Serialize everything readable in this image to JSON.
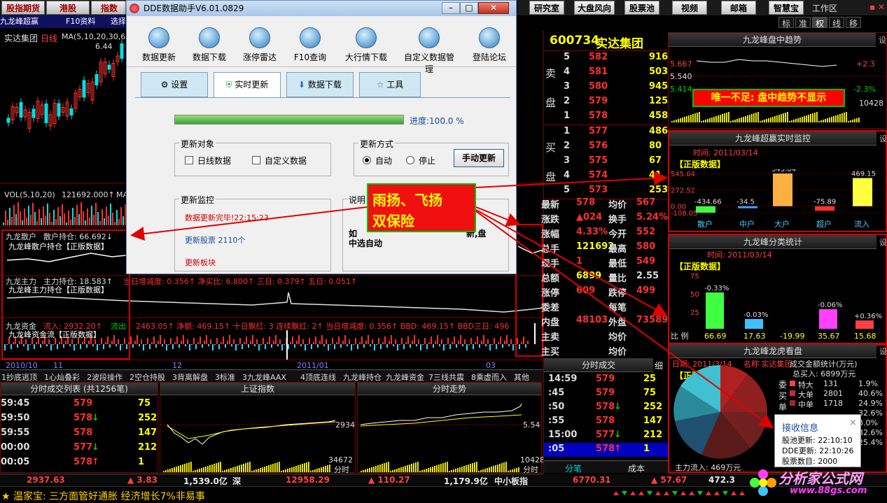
{
  "topbar": {
    "left": [
      "股指期货",
      "港股",
      "指数"
    ],
    "right": [
      "研究室",
      "大盘风向",
      "股票池",
      "视频",
      "邮箱",
      "智慧宝"
    ],
    "workspace": "工作区",
    "right_tabs": [
      "标",
      "准",
      "权",
      "线",
      "移"
    ]
  },
  "chart": {
    "stock_title": "实达集团",
    "period": "日线",
    "ma_label": "MA(5,10,20,30,60)",
    "price_tag": "6.44",
    "vol_label": "VOL(5,10,20)",
    "vol_value": "121692.000↑",
    "vol_ma": "MA",
    "retail_label": "九龙散户",
    "retail_value": "散户持仓: 66.692↓",
    "retail_badge": "九龙峰散户持仓【正版数据】",
    "main_label": "九龙主力",
    "main_value": "主力持仓: 18.583↑",
    "main_extra": "当日增减度: 0.356↑ 净买比: 6.800↑ 三日: 0.379↑ 五日: 0.051↑",
    "main_badge": "九龙峰主力持仓【正版数据】",
    "fund_label": "九龙资金",
    "fund_in": "流入: 2932.20↑",
    "fund_out": "流出",
    "fund_vals": "2463.05↑ 净额: 469.15↑ 十日飘红: 3 连续飘红: 2↑ 当日增减度: 0.356↑ BBD: 469.15↑ BBD三日: 496",
    "fund_badge": "九龙峰资金流【正版数据】",
    "dates": [
      "2010/10",
      "11",
      "12",
      "2011/01",
      "03"
    ],
    "left_tabs": [
      "F10资料",
      "选择"
    ],
    "left_stock": "九龙峰超赢"
  },
  "bottom_tabs": [
    "1抄底逃顶",
    "1心灿叠彩",
    "2波段操作",
    "2空仓持股",
    "3背离解盘",
    "3标准",
    "3九龙峰AAX",
    "4顶底连线",
    "九龙峰持仓",
    "九龙峰资金",
    "7三线共震",
    "8乘虚而入",
    "其他"
  ],
  "trades_title": "分时成交列表 (共1256笔)",
  "trades": [
    {
      "t": "59:45",
      "p": "579",
      "v": "75",
      "arrow": ""
    },
    {
      "t": "59:50",
      "p": "578",
      "v": "252",
      "arrow": "↓"
    },
    {
      "t": "59:55",
      "p": "578",
      "v": "147",
      "arrow": ""
    },
    {
      "t": "00:00",
      "p": "577",
      "v": "212",
      "arrow": "↓"
    },
    {
      "t": "00:05",
      "p": "578",
      "v": "1",
      "arrow": "↑"
    }
  ],
  "index_title": "上证指数",
  "index_val": "2934",
  "index_vol": "34672",
  "index_time": "分时",
  "intraday_title": "分时走势",
  "intraday_val": "5.54",
  "intraday_vol": "10428",
  "intraday_time": "分时",
  "status": {
    "v1": "2937.63",
    "v2": "▲ 3.83",
    "v3": "1,539.0亿",
    "v4": "深",
    "v5": "12958.29",
    "v6": "▲ 110.27",
    "v7": "1,179.9亿",
    "v8": "中小板指",
    "v9": "6770.31",
    "v10": "▲ 57.67",
    "v11": "472.3"
  },
  "ticker": "★ 温家宝: 三方面管好通胀 经济增长7%非易事",
  "quote": {
    "code": "600734",
    "name": "实达集团",
    "sell_label": [
      "卖",
      "盘"
    ],
    "buy_label": [
      "买",
      "盘"
    ],
    "sells": [
      {
        "n": "5",
        "p": "582",
        "v": "916"
      },
      {
        "n": "4",
        "p": "581",
        "v": "503"
      },
      {
        "n": "3",
        "p": "580",
        "v": "945"
      },
      {
        "n": "2",
        "p": "579",
        "v": "125"
      },
      {
        "n": "1",
        "p": "578",
        "v": "458"
      }
    ],
    "buys": [
      {
        "n": "1",
        "p": "577",
        "v": "486"
      },
      {
        "n": "2",
        "p": "576",
        "v": "80"
      },
      {
        "n": "3",
        "p": "575",
        "v": "67"
      },
      {
        "n": "4",
        "p": "574",
        "v": "41"
      },
      {
        "n": "5",
        "p": "573",
        "v": "253"
      }
    ],
    "stats": [
      [
        "最新",
        "578",
        "均价",
        "567"
      ],
      [
        "涨跌",
        "▲024",
        "换手",
        "5.24%"
      ],
      [
        "涨幅",
        "4.33%",
        "今开",
        "552"
      ],
      [
        "总手",
        "121692",
        "最高",
        "580"
      ],
      [
        "现手",
        "1",
        "最低",
        "549"
      ],
      [
        "总额",
        "6899",
        "量比",
        "2.55"
      ],
      [
        "涨停",
        "609",
        "跌停",
        "499"
      ],
      [
        "委差",
        "",
        "每笔",
        ""
      ],
      [
        "内盘",
        "48103",
        "外盘",
        "73589"
      ],
      [
        "主卖",
        "",
        "均价",
        ""
      ],
      [
        "主买",
        "",
        "均价",
        ""
      ]
    ],
    "ticks_title": "分时成交",
    "ticks_tab": "细",
    "ticks": [
      {
        "t": "14:59",
        "p": "579",
        "v": "25",
        "arrow": ""
      },
      {
        "t": ":45",
        "p": "579",
        "v": "75",
        "arrow": ""
      },
      {
        "t": ":50",
        "p": "578",
        "v": "252",
        "arrow": "↓"
      },
      {
        "t": ":55",
        "p": "578",
        "v": "147",
        "arrow": ""
      },
      {
        "t": "15:00",
        "p": "577",
        "v": "212",
        "arrow": "↓"
      },
      {
        "t": ":05",
        "p": "578",
        "v": "1",
        "arrow": "↑"
      }
    ],
    "bottom_tabs": [
      "分笔",
      "成本"
    ]
  },
  "panel1": {
    "title": "九龙峰盘中趋势",
    "labels": [
      "5.667",
      "5.540",
      "5.414"
    ],
    "right": [
      "+2.3",
      "-2.3%"
    ],
    "vol": "10428",
    "note": "唯一不足: 盘中趋势不显示",
    "side": "设"
  },
  "panel2": {
    "title": "九龙峰超赢实时监控",
    "date": "时间: 2011/03/14",
    "badge": "【正版数据】",
    "yaxis": [
      "545.04",
      "272.52",
      "0.00",
      "-108.05"
    ],
    "bars": [
      {
        "name": "散户",
        "value": -434.66,
        "label": "-434.66"
      },
      {
        "name": "中户",
        "value": -34.5,
        "label": "-34.5"
      },
      {
        "name": "大户",
        "value": 545.04,
        "label": "545.04"
      },
      {
        "name": "超户",
        "value": -75.89,
        "label": "-75.89"
      },
      {
        "name": "流入",
        "value": 469.15,
        "label": "469.15"
      }
    ],
    "side": "设"
  },
  "panel3": {
    "title": "九龙峰分类统计",
    "date": "时间: 2011/03/14",
    "badge": "【正版数据】",
    "yaxis": [
      "75",
      "50",
      "25"
    ],
    "cats": [
      {
        "pct": "-0.33%",
        "val": "66.69"
      },
      {
        "pct": "-0.03%",
        "val": "17.63"
      },
      {
        "pct": "",
        "val": "-19.99"
      },
      {
        "pct": "-0.06%",
        "val": "35.67"
      },
      {
        "pct": "+0.36%",
        "val": "15.68"
      }
    ],
    "foot": "比 例",
    "side": "设"
  },
  "panel4": {
    "title": "九龙峰龙虎看盘",
    "date": "日期: 2011/3/14",
    "name": "名称 实达集团",
    "badge": "【正版数据】",
    "stat_title": "成交金额统计(万元)",
    "total_buy": "总买入: 6899万元",
    "side_labels": [
      "委",
      "买",
      "单"
    ],
    "rows": [
      {
        "k": "特大",
        "v": "131",
        "p": "1.9%"
      },
      {
        "k": "大单",
        "v": "2801",
        "p": "40.6%"
      },
      {
        "k": "中单",
        "v": "1718",
        "p": "24.9%"
      },
      {
        "k": "",
        "v": "",
        "p": "32.6%"
      },
      {
        "k": "",
        "v": "",
        "p": "3.0%"
      },
      {
        "k": "",
        "v": "",
        "p": "32.6%"
      },
      {
        "k": "",
        "v": "",
        "p": "25.4%"
      }
    ],
    "inflow": "主力流入: 469万元",
    "side": "设"
  },
  "popup": {
    "title": "接收信息",
    "close": "×",
    "lines": [
      "股池更新: 22:10:10",
      "DDE更新: 22:10:26",
      "股票数目: 2000"
    ]
  },
  "dialog": {
    "title": "DDE数据助手V6.01.0829",
    "icons": [
      "数据更新",
      "数据下载",
      "涨停雷达",
      "F10查询",
      "大行情下载",
      "自定义数据管理",
      "登陆论坛"
    ],
    "tabs": [
      "设置",
      "实时更新",
      "数据下载",
      "工具"
    ],
    "progress_label": "进度:100.0 %",
    "progress": 1.0,
    "update_target": "更新对象",
    "cb_daily": "日线数据",
    "cb_custom": "自定义数据",
    "update_mode": "更新方式",
    "rb_auto": "自动",
    "rb_stop": "停止",
    "manual_btn": "手动更新",
    "monitor": "更新监控",
    "mon_lines": [
      "数据更新完毕!22:15:23",
      "更新股票 2110个",
      "更新板块"
    ],
    "desc": "说明",
    "desc_text": "中选自动",
    "desc_text2": "新,盘",
    "desc_text3": "如"
  },
  "callout": {
    "line1": "雨扬、飞扬",
    "line2": "双保险"
  },
  "watermark": {
    "text": "分析家公式网",
    "url": "www.88gs.com"
  },
  "colors": {
    "accent_red": "#d00000",
    "up": "#ff3030",
    "down": "#00d000",
    "neutral": "#ffff00"
  }
}
